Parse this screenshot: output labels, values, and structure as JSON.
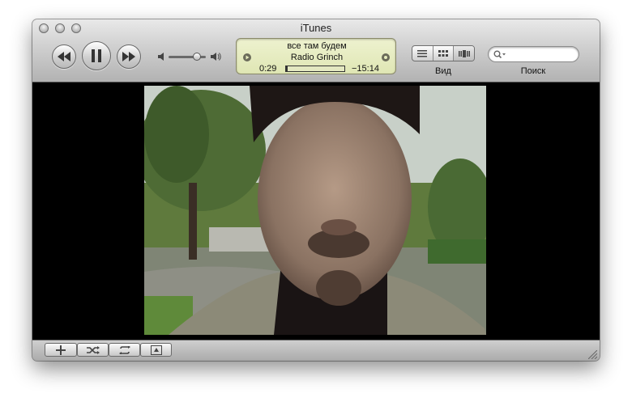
{
  "window": {
    "title": "iTunes"
  },
  "now_playing": {
    "track_title": "все там будем",
    "artist": "Radio Grinch",
    "elapsed": "0:29",
    "remaining": "−15:14",
    "progress_fraction": 0.03
  },
  "volume": {
    "level_fraction": 0.82
  },
  "toolbar": {
    "view_label": "Вид",
    "search_label": "Поиск",
    "search_value": ""
  },
  "icons": {
    "previous": "rewind-icon",
    "play_pause": "pause-icon",
    "next": "fast-forward-icon",
    "volume_low": "speaker-low-icon",
    "volume_high": "speaker-high-icon",
    "add": "plus-icon",
    "shuffle": "shuffle-icon",
    "repeat": "repeat-icon",
    "artwork": "artwork-icon"
  }
}
